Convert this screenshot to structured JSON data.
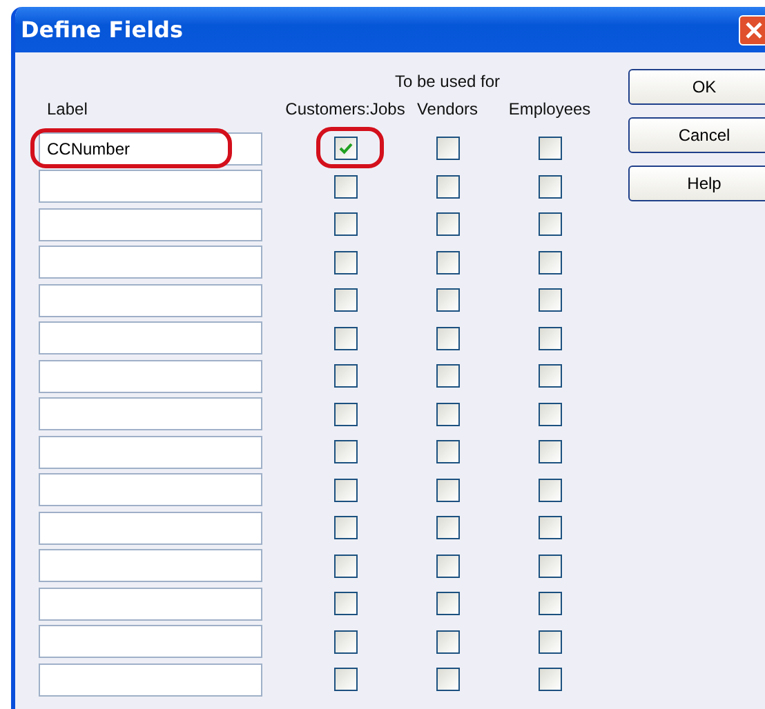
{
  "window": {
    "title": "Define Fields"
  },
  "header": {
    "label_column": "Label",
    "group": "To be used for",
    "columns": [
      "Customers:Jobs",
      "Vendors",
      "Employees"
    ]
  },
  "rows": [
    {
      "value": "CCNumber",
      "highlighted": true,
      "checkboxes": [
        {
          "checked": true
        },
        {
          "checked": false
        },
        {
          "checked": false
        }
      ]
    },
    {
      "checkboxes": [
        {
          "checked": false
        },
        {
          "checked": false
        },
        {
          "checked": false
        }
      ]
    },
    {
      "checkboxes": [
        {
          "checked": false
        },
        {
          "checked": false
        },
        {
          "checked": false
        }
      ]
    },
    {
      "checkboxes": [
        {
          "checked": false
        },
        {
          "checked": false
        },
        {
          "checked": false
        }
      ]
    },
    {
      "checkboxes": [
        {
          "checked": false
        },
        {
          "checked": false
        },
        {
          "checked": false
        }
      ]
    },
    {
      "checkboxes": [
        {
          "checked": false
        },
        {
          "checked": false
        },
        {
          "checked": false
        }
      ]
    },
    {
      "checkboxes": [
        {
          "checked": false
        },
        {
          "checked": false
        },
        {
          "checked": false
        }
      ]
    },
    {
      "checkboxes": [
        {
          "checked": false
        },
        {
          "checked": false
        },
        {
          "checked": false
        }
      ]
    },
    {
      "checkboxes": [
        {
          "checked": false
        },
        {
          "checked": false
        },
        {
          "checked": false
        }
      ]
    },
    {
      "checkboxes": [
        {
          "checked": false
        },
        {
          "checked": false
        },
        {
          "checked": false
        }
      ]
    },
    {
      "checkboxes": [
        {
          "checked": false
        },
        {
          "checked": false
        },
        {
          "checked": false
        }
      ]
    },
    {
      "checkboxes": [
        {
          "checked": false
        },
        {
          "checked": false
        },
        {
          "checked": false
        }
      ]
    },
    {
      "checkboxes": [
        {
          "checked": false
        },
        {
          "checked": false
        },
        {
          "checked": false
        }
      ]
    },
    {
      "checkboxes": [
        {
          "checked": false
        },
        {
          "checked": false
        },
        {
          "checked": false
        }
      ]
    },
    {
      "checkboxes": [
        {
          "checked": false
        },
        {
          "checked": false
        },
        {
          "checked": false
        }
      ]
    }
  ],
  "buttons": [
    "OK",
    "Cancel",
    "Help"
  ]
}
